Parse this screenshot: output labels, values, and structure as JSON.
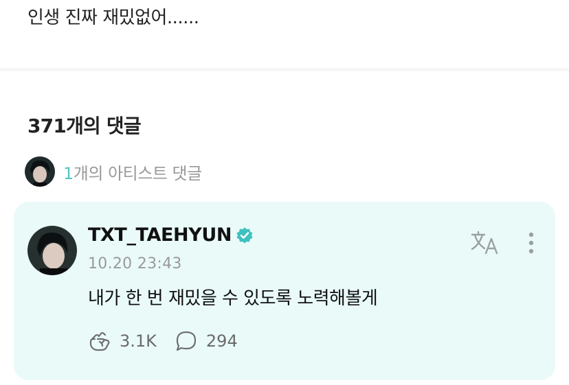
{
  "post": {
    "text": "인생 진짜 재밌없어......"
  },
  "comments": {
    "count": "371",
    "count_suffix": "개의 댓글",
    "artist_count": "1",
    "artist_suffix": "개의 아티스트 댓글"
  },
  "comment": {
    "username": "TXT_TAEHYUN",
    "timestamp": "10.20 23:43",
    "text": "내가 한 번 재밌을 수 있도록 노력해볼게",
    "likes": "3.1K",
    "replies": "294"
  },
  "colors": {
    "accent": "#4fc6c3",
    "card_bg": "#e9faf9",
    "verified": "#3fc1c0"
  },
  "icons": {
    "translate": "translate-icon",
    "more": "more-vertical-icon",
    "like": "heart-hand-icon",
    "reply": "speech-bubble-icon",
    "verified": "verified-badge-icon"
  }
}
